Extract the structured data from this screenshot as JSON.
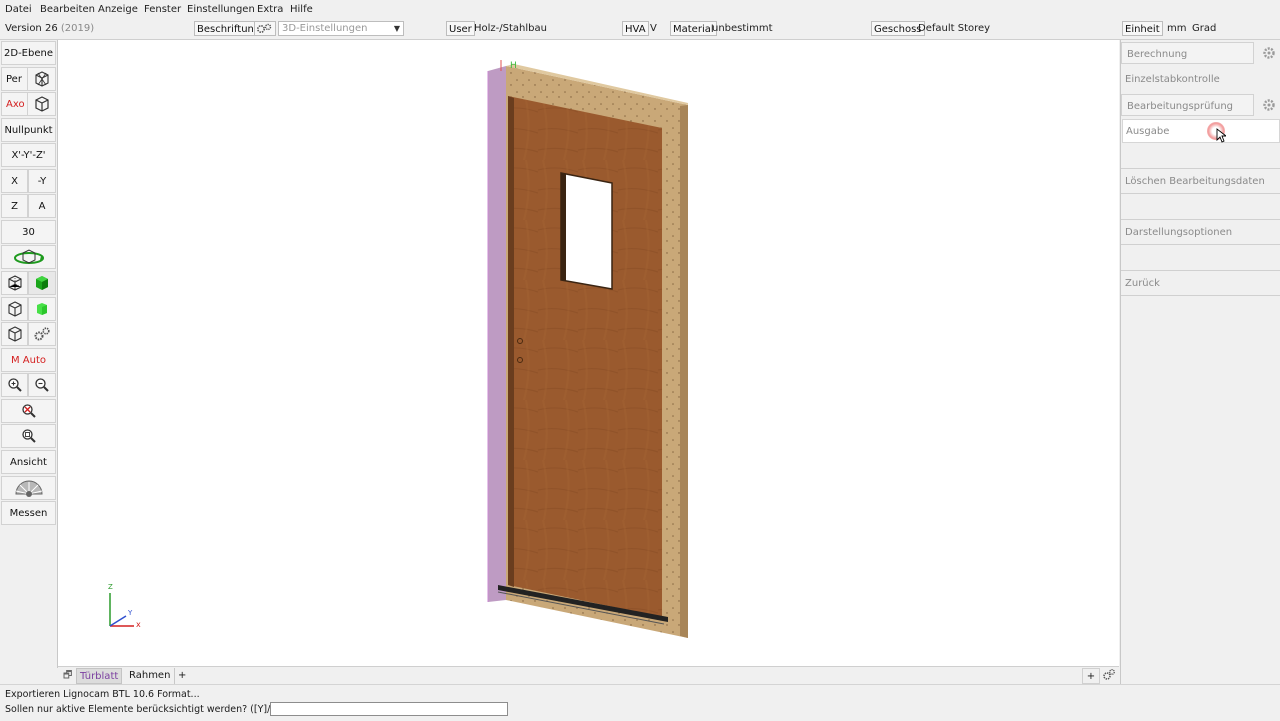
{
  "menu": [
    "Datei",
    "Bearbeiten",
    "Anzeige",
    "Fenster",
    "Einstellungen",
    "Extra",
    "Hilfe"
  ],
  "toolbar": {
    "version": "Version 26",
    "version_year": "(2019)",
    "beschriftung": "Beschriftung",
    "settings_select": "3D-Einstellungen",
    "user_label": "User",
    "user_value": "Holz-/Stahlbau",
    "hva_label": "HVA",
    "hva_value": "V",
    "material_label": "Material",
    "material_value": "unbestimmt",
    "geschoss_label": "Geschoss",
    "geschoss_value": "Default Storey",
    "einheit_label": "Einheit",
    "einheit_unit": "mm",
    "einheit_angle": "Grad"
  },
  "left_toolbar": {
    "ebene2d": "2D-Ebene",
    "per": "Per",
    "axo": "Axo",
    "nullpunkt": "Nullpunkt",
    "xyz": "X'-Y'-Z'",
    "x": "X",
    "neg_y": "-Y",
    "z": "Z",
    "a": "A",
    "thirty": "30",
    "m_auto": "M Auto",
    "ansicht": "Ansicht",
    "messen": "Messen"
  },
  "right_panel": {
    "items": [
      "Berechnung",
      "Einzelstabkontrolle",
      "Bearbeitungsprüfung",
      "Ausgabe",
      "Löschen Bearbeitungsdaten",
      "Darstellungsoptionen",
      "Zurück"
    ]
  },
  "tabs": [
    "Türblatt",
    "Rahmen",
    "+"
  ],
  "tab_add": "+",
  "axis": {
    "z": "Z",
    "y": "Y",
    "x": "x"
  },
  "status": {
    "line1": "Exportieren Lignocam BTL 10.6 Format...",
    "line2": "Sollen nur aktive Elemente berücksichtigt werden? ([Y]/N)",
    "input_value": ""
  },
  "colors": {
    "accent_red": "#d42020",
    "active_tab": "#7b3fa0",
    "door": "#9a5a2e",
    "frame": "#c9a878",
    "green": "#2fb52f"
  }
}
